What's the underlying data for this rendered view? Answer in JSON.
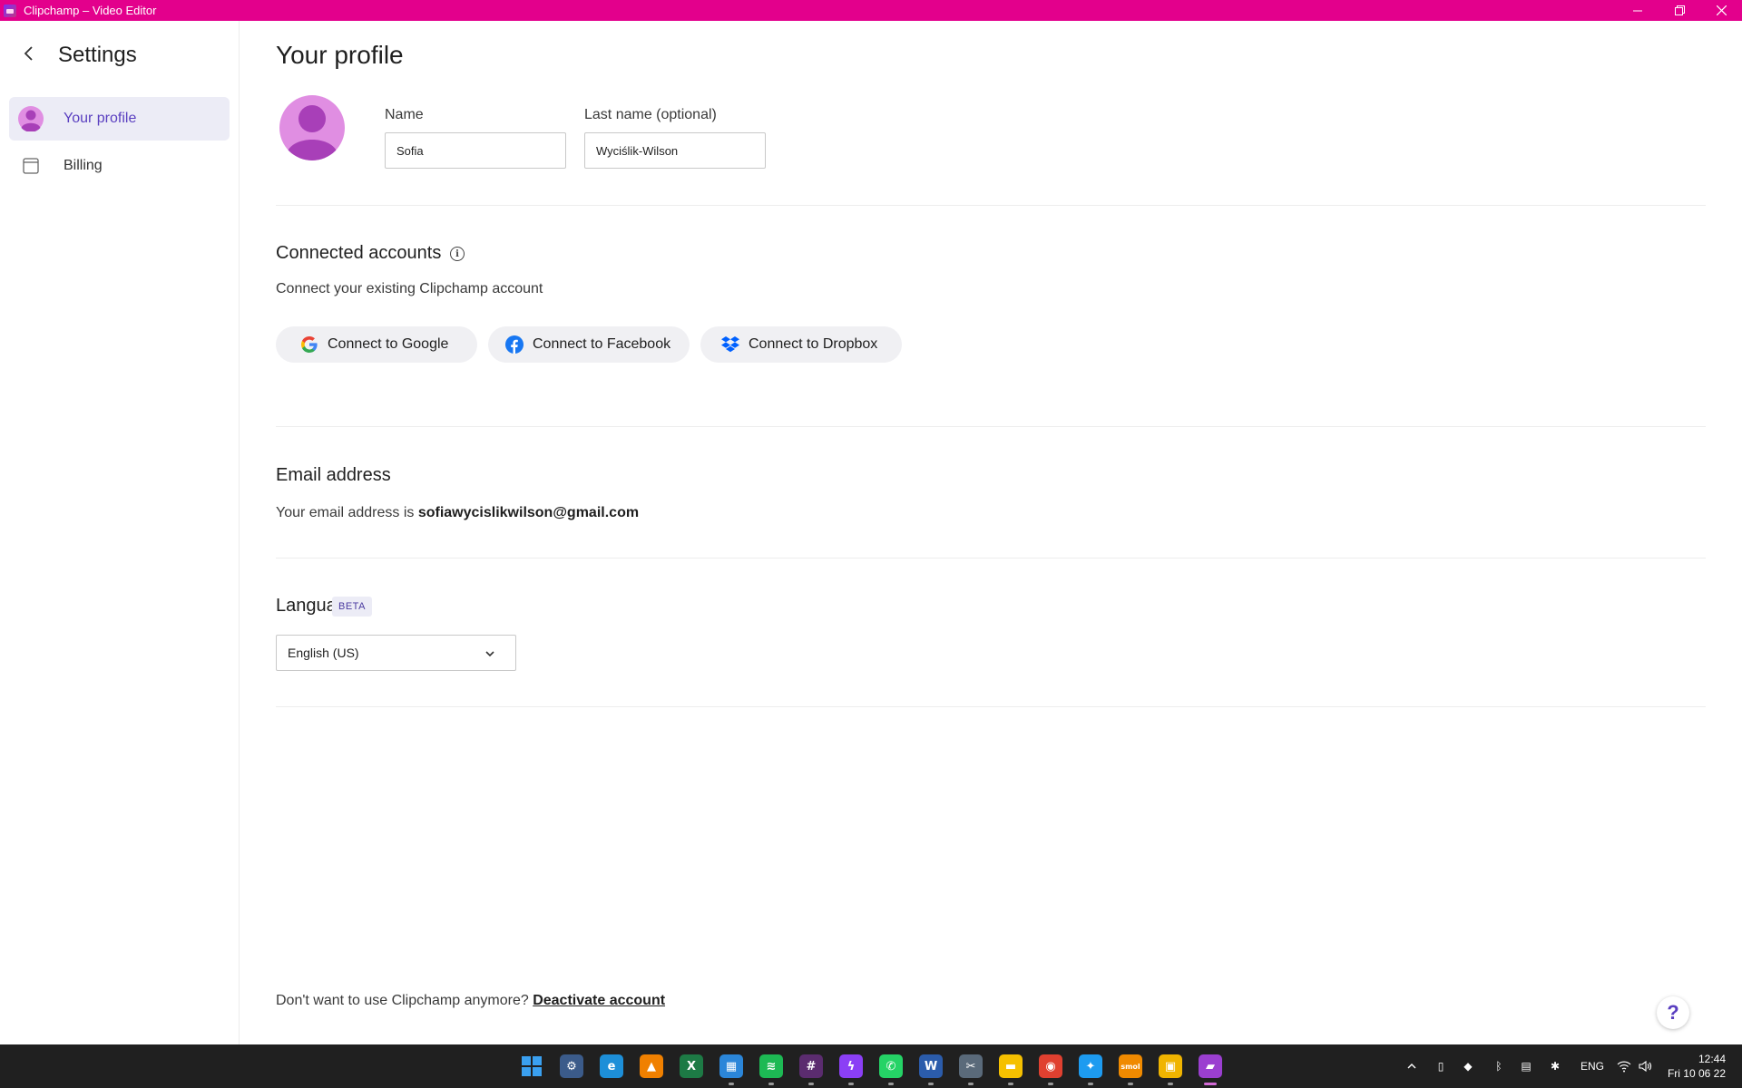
{
  "window": {
    "title": "Clipchamp – Video Editor",
    "controls": [
      "minimize-icon",
      "restore-icon",
      "close-icon"
    ],
    "title_color": "#e3008c"
  },
  "sidebar": {
    "heading": "Settings",
    "items": [
      {
        "label": "Your profile",
        "icon": "profile-icon",
        "active": true
      },
      {
        "label": "Billing",
        "icon": "billing-icon",
        "active": false
      }
    ]
  },
  "profile": {
    "title": "Your profile",
    "name_label": "Name",
    "name_value": "Sofia",
    "last_name_label": "Last name (optional)",
    "last_name_value": "Wyciślik-Wilson"
  },
  "connected_accounts": {
    "title": "Connected accounts",
    "description": "Connect your existing Clipchamp account",
    "buttons": [
      {
        "label": "Connect to Google",
        "icon": "google-icon"
      },
      {
        "label": "Connect to Facebook",
        "icon": "facebook-icon"
      },
      {
        "label": "Connect to Dropbox",
        "icon": "dropbox-icon"
      }
    ]
  },
  "email": {
    "title": "Email address",
    "prefix": "Your email address is",
    "address": "sofiawycislikwilson@gmail.com"
  },
  "language": {
    "title": "Language",
    "badge": "BETA",
    "selected": "English (US)"
  },
  "footer": {
    "question": "Don't want to use Clipchamp anymore?",
    "link": "Deactivate account"
  },
  "help": {
    "label": "?"
  },
  "taskbar": {
    "apps": [
      {
        "name": "start-icon",
        "glyph": "",
        "color": "#3aa0f0"
      },
      {
        "name": "settings-icon",
        "glyph": "⚙",
        "color": "#3b5b8a"
      },
      {
        "name": "edge-icon",
        "glyph": "e",
        "color": "#1d8fd8"
      },
      {
        "name": "vlc-icon",
        "glyph": "▲",
        "color": "#f08000"
      },
      {
        "name": "excel-icon",
        "glyph": "X",
        "color": "#1d7a45"
      },
      {
        "name": "app-icon",
        "glyph": "▦",
        "color": "#2b86d9"
      },
      {
        "name": "spotify-icon",
        "glyph": "≋",
        "color": "#1db954"
      },
      {
        "name": "slack-icon",
        "glyph": "#",
        "color": "#5b2c6f"
      },
      {
        "name": "messenger-icon",
        "glyph": "ϟ",
        "color": "#8b3ff5"
      },
      {
        "name": "whatsapp-icon",
        "glyph": "✆",
        "color": "#25d366"
      },
      {
        "name": "word-icon",
        "glyph": "W",
        "color": "#2b5cab"
      },
      {
        "name": "snip-icon",
        "glyph": "✂",
        "color": "#5a6a7a"
      },
      {
        "name": "explorer-icon",
        "glyph": "▬",
        "color": "#f5c000"
      },
      {
        "name": "chrome-icon",
        "glyph": "◉",
        "color": "#e04030"
      },
      {
        "name": "twitter-icon",
        "glyph": "✦",
        "color": "#1d9bf0"
      },
      {
        "name": "smol-icon",
        "glyph": "smol",
        "color": "#f08a00"
      },
      {
        "name": "store-icon",
        "glyph": "▣",
        "color": "#f0b400"
      },
      {
        "name": "clipchamp-icon",
        "glyph": "▰",
        "color": "#9b3fd0"
      }
    ],
    "tray": {
      "lang": "ENG",
      "time": "12:44",
      "date": "Fri 10 06 22"
    }
  }
}
